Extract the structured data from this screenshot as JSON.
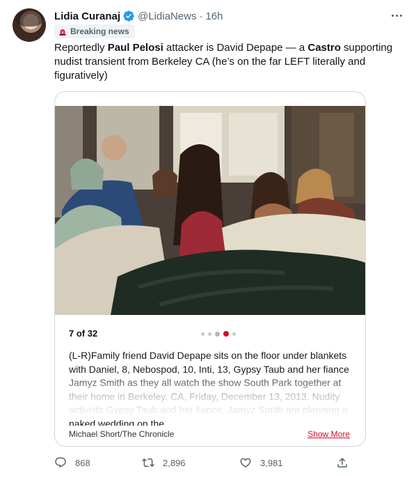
{
  "author": {
    "display_name": "Lidia Curanaj",
    "handle": "@LidiaNews",
    "separator": "·",
    "time": "16h",
    "verified": true
  },
  "label": {
    "icon": "siren-icon",
    "text": "Breaking news"
  },
  "tweet": {
    "text_parts": [
      "Reportedly ",
      "Paul Pelosi",
      " attacker is David Depape — a ",
      "Castro",
      " supporting nudist transient from Berkeley CA (he’s on the far LEFT literally and figuratively)"
    ]
  },
  "card": {
    "photo_icon": "family-photo",
    "counter": "7 of 32",
    "caption": "(L-R)Family friend David Depape sits on the floor under blankets with Daniel, 8, Nebospod, 10, Inti, 13, Gypsy Taub and her fiance Jamyz Smith as they all watch the show South Park together at their home in Berkeley, CA, Friday, December 13, 2013. Nudity activists Gypsy Taub and her fiance, Jamyz Smith are planning a naked wedding on the",
    "credit": "Michael Short/The Chronicle",
    "show_more": "Show More",
    "accent_color": "#d0102b"
  },
  "actions": {
    "reply_count": "868",
    "retweet_count": "2,896",
    "like_count": "3,981"
  },
  "colors": {
    "verified": "#1d9bf0",
    "secondary_text": "#536471"
  }
}
